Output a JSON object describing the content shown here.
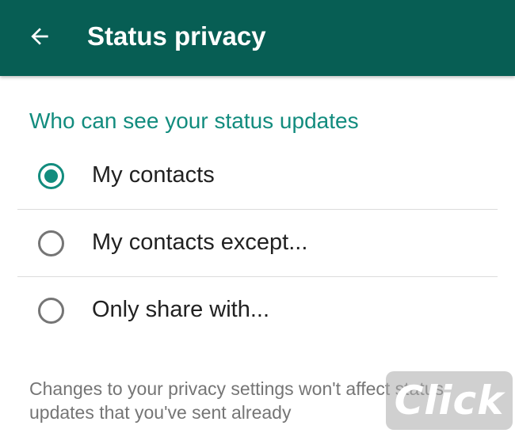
{
  "app_bar": {
    "title": "Status privacy",
    "back_icon": "arrow-back-icon",
    "background": "#075e54"
  },
  "section": {
    "header": "Who can see your status updates",
    "accent_color": "#128c7e"
  },
  "options": [
    {
      "label": "My contacts",
      "selected": true
    },
    {
      "label": "My contacts except...",
      "selected": false
    },
    {
      "label": "Only share with...",
      "selected": false
    }
  ],
  "footer": {
    "note": "Changes to your privacy settings won't affect status updates that you've sent already"
  },
  "watermark": {
    "text": "Click"
  }
}
